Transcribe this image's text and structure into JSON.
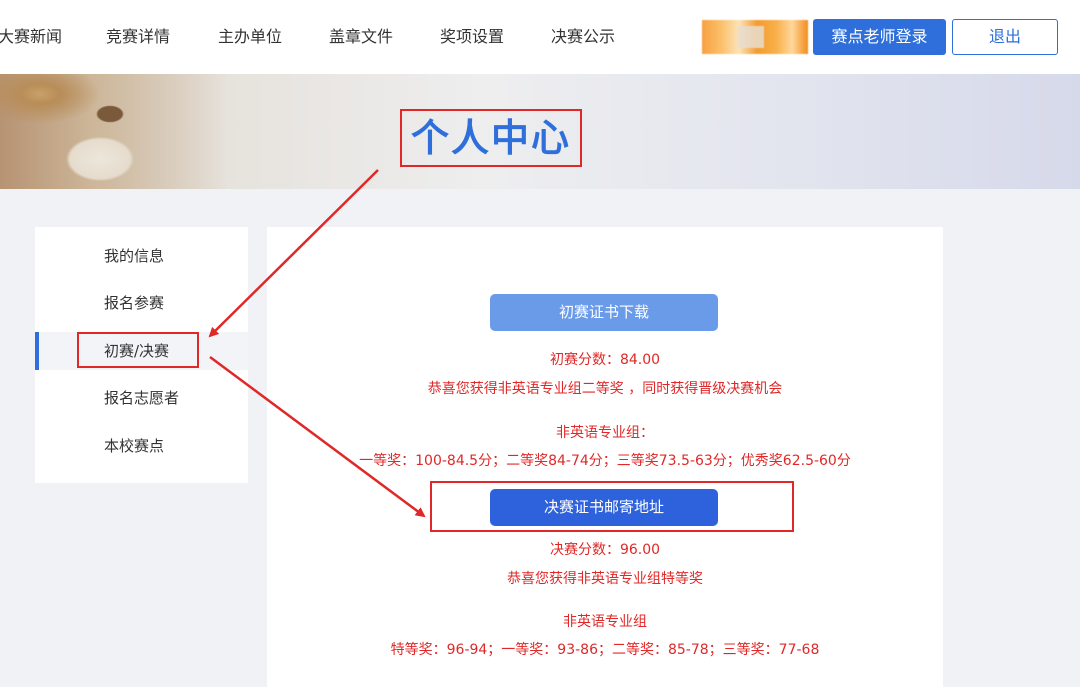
{
  "nav": {
    "items": [
      "大赛新闻",
      "竞赛详情",
      "主办单位",
      "盖章文件",
      "奖项设置",
      "决赛公示"
    ],
    "login_button": "赛点老师登录",
    "logout_button": "退出"
  },
  "banner": {
    "title": "个人中心"
  },
  "sidebar": {
    "items": [
      {
        "label": "我的信息"
      },
      {
        "label": "报名参赛"
      },
      {
        "label": "初赛/决赛"
      },
      {
        "label": "报名志愿者"
      },
      {
        "label": "本校赛点"
      }
    ]
  },
  "main": {
    "prelim_button": "初赛证书下载",
    "prelim_score": "初赛分数：84.00",
    "prelim_award": "恭喜您获得非英语专业组二等奖 ，同时获得晋级决赛机会",
    "prelim_group": "非英语专业组：",
    "prelim_levels": "一等奖：100-84.5分；二等奖84-74分；三等奖73.5-63分；优秀奖62.5-60分",
    "final_button": "决赛证书邮寄地址",
    "final_score": "决赛分数：96.00",
    "final_award": "恭喜您获得非英语专业组特等奖",
    "final_group": "非英语专业组",
    "final_levels": "特等奖：96-94；一等奖：93-86；二等奖：85-78；三等奖：77-68"
  },
  "colors": {
    "accent": "#2e6fdb",
    "annotation_red": "#e02828",
    "result_text": "#e02828"
  }
}
